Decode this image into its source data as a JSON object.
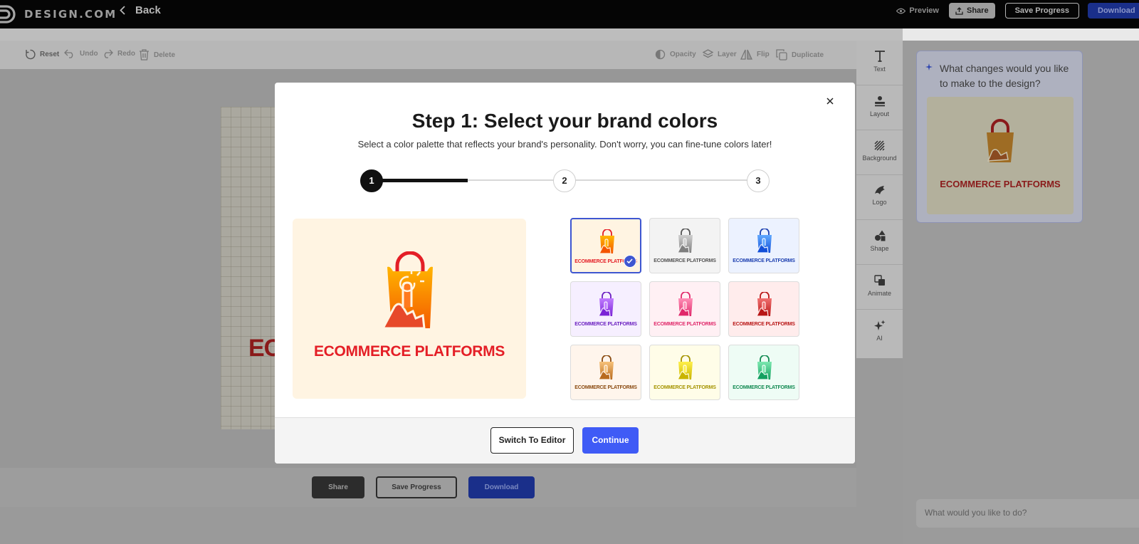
{
  "app": {
    "brand": "DESIGN.COM",
    "back_label": "Back",
    "preview_label": "Preview",
    "share_label": "Share",
    "save_label": "Save Progress",
    "download_label": "Download"
  },
  "toolbar": {
    "reset": "Reset",
    "undo": "Undo",
    "redo": "Redo",
    "delete": "Delete",
    "opacity": "Opacity",
    "layer": "Layer",
    "flip": "Flip",
    "duplicate": "Duplicate"
  },
  "canvas": {
    "logo_text_fragment": "EC"
  },
  "bottom_bar": {
    "share": "Share",
    "save": "Save Progress",
    "download": "Download"
  },
  "side_tools": [
    {
      "label": "Text",
      "icon": "text-icon"
    },
    {
      "label": "Layout",
      "icon": "layout-icon"
    },
    {
      "label": "Background",
      "icon": "background-icon"
    },
    {
      "label": "Logo",
      "icon": "logo-icon"
    },
    {
      "label": "Shape",
      "icon": "shape-icon"
    },
    {
      "label": "Animate",
      "icon": "animate-icon"
    },
    {
      "label": "AI",
      "icon": "sparkle-icon"
    }
  ],
  "ai_panel": {
    "question": "What changes would you like to make to the design?",
    "thumb_text": "ECOMMERCE PLATFORMS",
    "input_placeholder": "What would you like to do?"
  },
  "modal": {
    "title": "Step 1: Select your brand colors",
    "subtitle": "Select a color palette that reflects your brand's personality. Don't worry, you can fine-tune colors later!",
    "steps": [
      "1",
      "2",
      "3"
    ],
    "current_step": 1,
    "step_progress": 0.25,
    "preview_text": "ECOMMERCE PLATFORMS",
    "switch_label": "Switch To Editor",
    "continue_label": "Continue",
    "palettes": [
      {
        "text": "ECOMMERCE PLATFORMS",
        "bg": "#fff4e2",
        "bag_top": "#ffb800",
        "bag_bottom": "#f45500",
        "text_color": "#e41e26",
        "selected": true
      },
      {
        "text": "ECOMMERCE PLATFORMS",
        "bg": "#f3f3f3",
        "bag_top": "#cfcfcf",
        "bag_bottom": "#7f7f7f",
        "text_color": "#555555",
        "selected": false
      },
      {
        "text": "ECOMMERCE PLATFORMS",
        "bg": "#ecf2ff",
        "bag_top": "#5fa8ff",
        "bag_bottom": "#1450d8",
        "text_color": "#1c3fb0",
        "selected": false
      },
      {
        "text": "ECOMMERCE PLATFORMS",
        "bg": "#f6efff",
        "bag_top": "#c07cff",
        "bag_bottom": "#7a24d6",
        "text_color": "#6a1fc0",
        "selected": false
      },
      {
        "text": "ECOMMERCE PLATFORMS",
        "bg": "#fff0f4",
        "bag_top": "#ff8fb6",
        "bag_bottom": "#e0286a",
        "text_color": "#e0286a",
        "selected": false
      },
      {
        "text": "ECOMMERCE PLATFORMS",
        "bg": "#ffecec",
        "bag_top": "#f07070",
        "bag_bottom": "#b81616",
        "text_color": "#b81616",
        "selected": false
      },
      {
        "text": "ECOMMERCE PLATFORMS",
        "bg": "#fff5ec",
        "bag_top": "#f7c27a",
        "bag_bottom": "#b86a1e",
        "text_color": "#8a4a10",
        "selected": false
      },
      {
        "text": "ECOMMERCE PLATFORMS",
        "bg": "#fffde8",
        "bag_top": "#fff04a",
        "bag_bottom": "#c9b400",
        "text_color": "#a59400",
        "selected": false
      },
      {
        "text": "ECOMMERCE PLATFORMS",
        "bg": "#eefcf5",
        "bag_top": "#7de8b0",
        "bag_bottom": "#13a060",
        "text_color": "#128a52",
        "selected": false
      }
    ]
  },
  "colors": {
    "accent": "#3f5bf6",
    "selected_border": "#3e56d1",
    "logo_red": "#e41e26"
  }
}
